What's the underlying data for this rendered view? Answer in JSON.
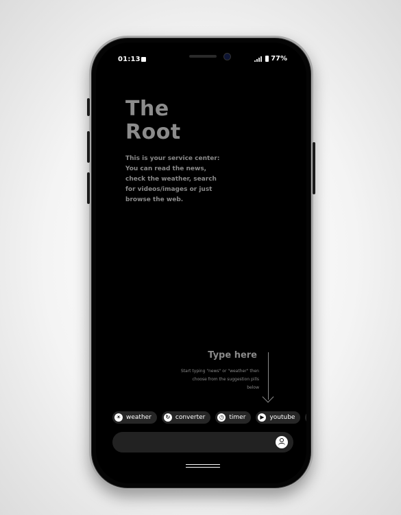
{
  "status_bar": {
    "time": "01:13",
    "battery": "77%"
  },
  "hero": {
    "title_line1": "The",
    "title_line2": "Root",
    "description": "This is your service center: You can read the news, check the weather, search for videos/images or just browse the web."
  },
  "hint": {
    "title": "Type here",
    "text": "Start typing \"news\" or \"weather\" then choose from the suggestion pills below"
  },
  "pills": [
    {
      "label": "weather",
      "icon": "sun-icon"
    },
    {
      "label": "converter",
      "icon": "refresh-icon"
    },
    {
      "label": "timer",
      "icon": "clock-icon"
    },
    {
      "label": "youtube",
      "icon": "play-icon"
    }
  ],
  "search": {
    "placeholder": ""
  }
}
